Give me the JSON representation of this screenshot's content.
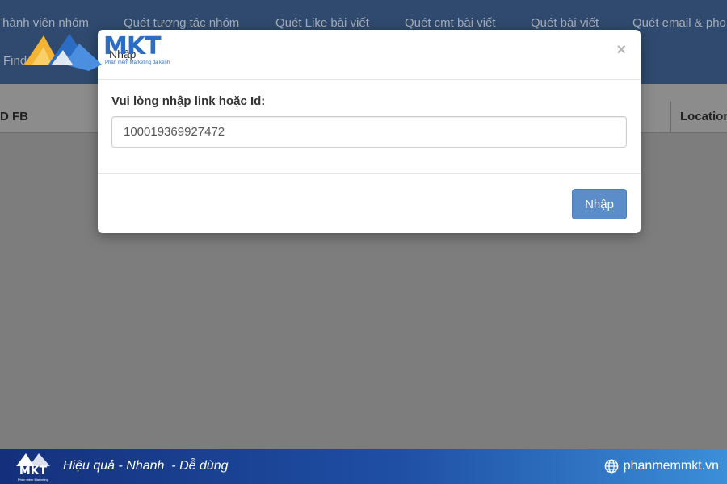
{
  "nav": {
    "items": [
      {
        "label": "Thành viên nhóm"
      },
      {
        "label": "Quét tương tác nhóm"
      },
      {
        "label": "Quét Like bài viết"
      },
      {
        "label": "Quét cmt bài viết"
      },
      {
        "label": "Quét bài viết"
      },
      {
        "label": "Quét email & pho"
      }
    ],
    "find_label": "Find"
  },
  "grid": {
    "col_idfb": "D FB",
    "col_location": "Location"
  },
  "logo": {
    "text": "MKT",
    "subtitle": "Phần mềm Marketing đa kênh"
  },
  "modal": {
    "title": "Nhập",
    "close_label": "×",
    "field_label": "Vui lòng nhập link hoặc Id:",
    "field_value": "100019369927472",
    "submit_label": "Nhập"
  },
  "banner": {
    "logo_text": "MKT",
    "logo_sub": "Phần mềm Marketing",
    "slogan": "Hiệu quả - Nhanh  - Dễ dùng",
    "website": "phanmemmkt.vn"
  },
  "colors": {
    "nav_bg": "#2f4a6e",
    "overlay_bg": "#7d7d7d",
    "accent": "#5b8dc9",
    "brand": "#2b6cc4"
  }
}
